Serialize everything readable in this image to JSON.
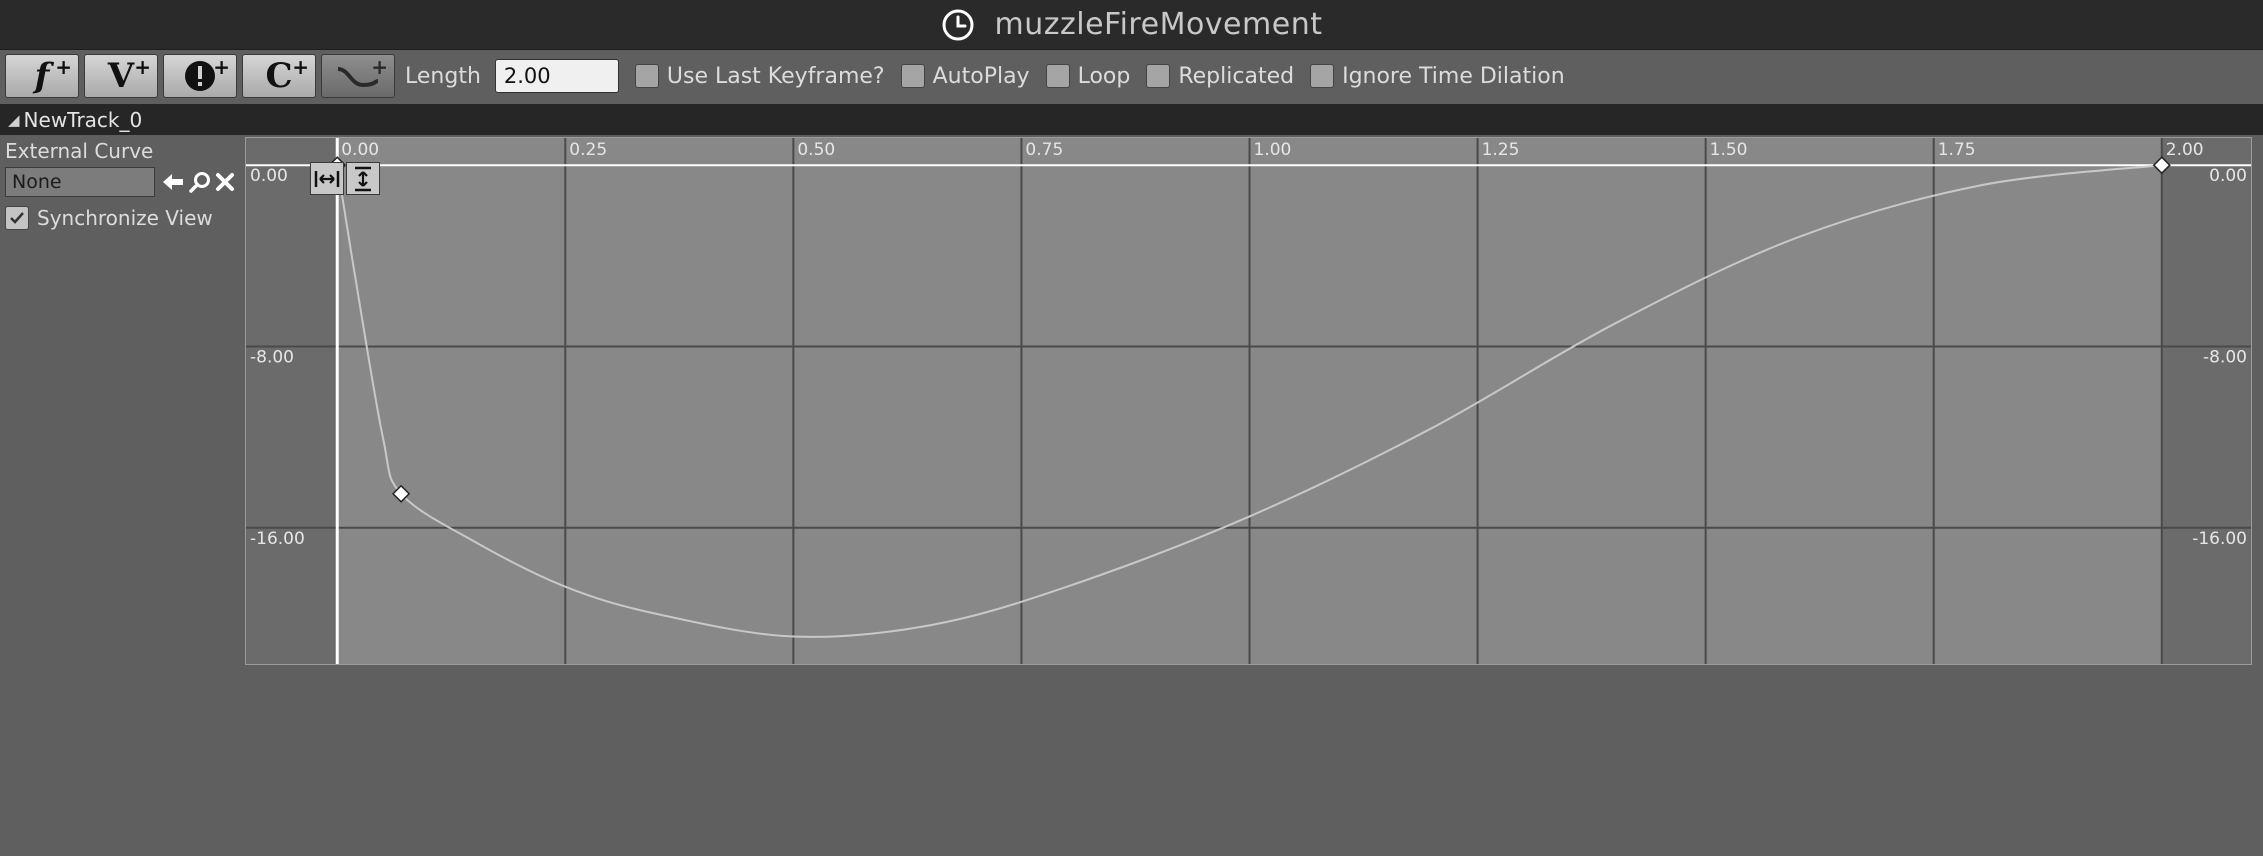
{
  "window": {
    "title": "muzzleFireMovement",
    "icon": "clock-icon"
  },
  "toolbar": {
    "buttons": [
      {
        "name": "add-float-track",
        "glyph": "f",
        "icon": "float-track-icon"
      },
      {
        "name": "add-vector-track",
        "glyph": "V",
        "icon": "vector-track-icon"
      },
      {
        "name": "add-event-track",
        "glyph": "!",
        "icon": "event-track-icon"
      },
      {
        "name": "add-color-track",
        "glyph": "C",
        "icon": "color-track-icon"
      },
      {
        "name": "add-curve-asset",
        "glyph": "",
        "icon": "curve-track-icon"
      }
    ],
    "length_label": "Length",
    "length_value": "2.00",
    "checkboxes": [
      {
        "label": "Use Last Keyframe?",
        "checked": false
      },
      {
        "label": "AutoPlay",
        "checked": false
      },
      {
        "label": "Loop",
        "checked": false
      },
      {
        "label": "Replicated",
        "checked": false
      },
      {
        "label": "Ignore Time Dilation",
        "checked": false
      }
    ]
  },
  "track": {
    "name": "NewTrack_0",
    "external_curve_label": "External Curve",
    "external_curve_value": "None",
    "synchronize_view_label": "Synchronize View",
    "synchronize_view_checked": true
  },
  "chart_data": {
    "type": "line",
    "x_ticks": [
      "0.00",
      "0.25",
      "0.50",
      "0.75",
      "1.00",
      "1.25",
      "1.50",
      "1.75",
      "2.00"
    ],
    "y_ticks": [
      "0.00",
      "-8.00",
      "-16.00"
    ],
    "xlim": [
      -0.1,
      2.1
    ],
    "ylim": [
      -22.1,
      1.2
    ],
    "timeline_length": 2.0,
    "keyframes": [
      {
        "time": 0.0,
        "value": 0.0
      },
      {
        "time": 0.07,
        "value": -14.5
      },
      {
        "time": 2.0,
        "value": 0.0
      }
    ],
    "curve": [
      {
        "x": 0.0,
        "y": 0.0
      },
      {
        "x": 0.02,
        "y": -5.0
      },
      {
        "x": 0.05,
        "y": -12.0
      },
      {
        "x": 0.07,
        "y": -14.5
      },
      {
        "x": 0.15,
        "y": -16.6
      },
      {
        "x": 0.25,
        "y": -18.6
      },
      {
        "x": 0.35,
        "y": -19.8
      },
      {
        "x": 0.5,
        "y": -20.8
      },
      {
        "x": 0.65,
        "y": -20.3
      },
      {
        "x": 0.8,
        "y": -18.6
      },
      {
        "x": 1.0,
        "y": -15.5
      },
      {
        "x": 1.2,
        "y": -11.6
      },
      {
        "x": 1.4,
        "y": -7.0
      },
      {
        "x": 1.6,
        "y": -3.2
      },
      {
        "x": 1.8,
        "y": -0.9
      },
      {
        "x": 2.0,
        "y": 0.0
      }
    ],
    "colors": {
      "background": "#888888",
      "outside_range": "#6b6b6b",
      "major_grid": "#4a4a4a",
      "curve": "#c8c8c8",
      "axis_line": "#ffffff",
      "key_fill": "#ffffff"
    }
  }
}
